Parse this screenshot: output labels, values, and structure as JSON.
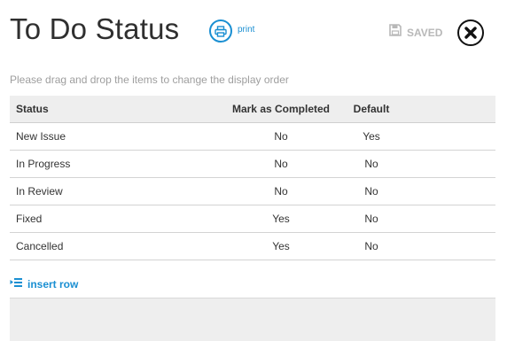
{
  "header": {
    "title": "To Do Status",
    "print_label": "print",
    "saved_label": "SAVED"
  },
  "instructions": "Please drag and drop the items to change the display order",
  "table": {
    "headers": {
      "status": "Status",
      "mark": "Mark as Completed",
      "default": "Default"
    },
    "rows": [
      {
        "status": "New Issue",
        "mark": "No",
        "default": "Yes"
      },
      {
        "status": "In Progress",
        "mark": "No",
        "default": "No"
      },
      {
        "status": "In Review",
        "mark": "No",
        "default": "No"
      },
      {
        "status": "Fixed",
        "mark": "Yes",
        "default": "No"
      },
      {
        "status": "Cancelled",
        "mark": "Yes",
        "default": "No"
      }
    ]
  },
  "insert_row_label": "insert row",
  "colors": {
    "accent": "#1a8fd2",
    "title": "#2f2f2f",
    "muted": "#b8b8b8",
    "header_bg": "#eeeeee"
  },
  "icons": {
    "print": "printer-icon",
    "saved": "floppy-disk-icon",
    "close": "close-icon",
    "insert": "insert-row-icon"
  }
}
